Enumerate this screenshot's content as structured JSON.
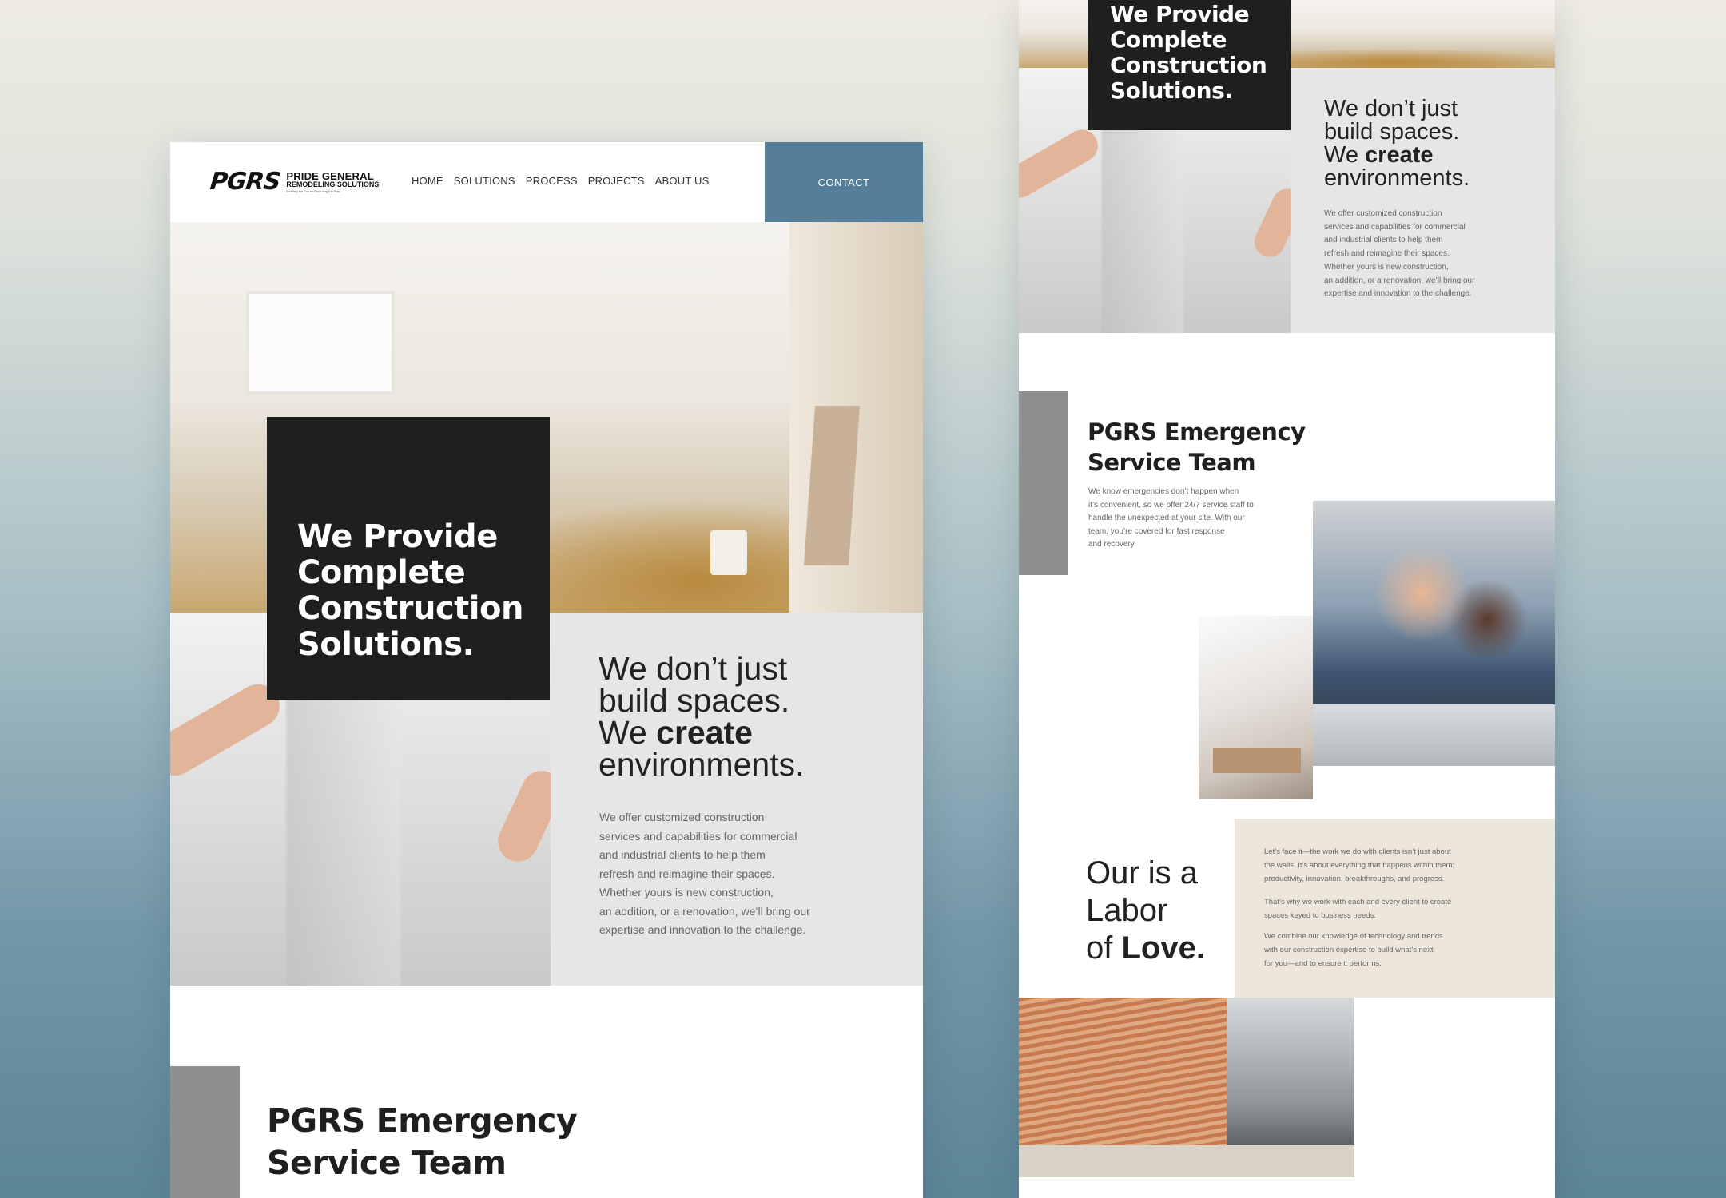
{
  "nav": {
    "logo_mark": "PGRS",
    "logo_line1": "PRIDE GENERAL",
    "logo_line2": "REMODELING SOLUTIONS",
    "logo_line3": "Building the Future Restoring the Past",
    "items": [
      "HOME",
      "SOLUTIONS",
      "PROCESS",
      "PROJECTS",
      "ABOUT US"
    ],
    "contact": "CONTACT"
  },
  "hero": {
    "lines": [
      "We Provide",
      "Complete",
      "Construction",
      "Solutions."
    ]
  },
  "tagline": {
    "line1": "We don’t just",
    "line2": "build spaces.",
    "line3_pre": "We ",
    "line3_bold": "create",
    "line4": "environments.",
    "body": [
      "We offer customized construction",
      "services and capabilities for commercial",
      "and industrial clients to help them",
      "refresh and reimagine their spaces.",
      "Whether yours is new construction,",
      "an addition, or a renovation, we’ll bring our",
      "expertise and innovation to the challenge."
    ]
  },
  "team": {
    "title_line1": "PGRS Emergency",
    "title_line2": "Service Team",
    "body": [
      "We know emergencies don’t happen when",
      "it’s convenient, so we offer 24/7 service staff to",
      "handle the unexpected at your site. With our",
      "team, you’re covered for fast response",
      "and recovery."
    ]
  },
  "love": {
    "line1": "Our is a",
    "line2": "Labor",
    "line3_pre": "of ",
    "line3_bold": "Love.",
    "p1": [
      "Let’s face it—the work we do with clients isn’t just about",
      "the walls. It’s about everything that happens within them:",
      "productivity, innovation, breakthroughs, and progress."
    ],
    "p2": [
      "That’s why we work with each and every client to create",
      "spaces keyed to business needs."
    ],
    "p3": [
      "We combine our knowledge of technology and trends",
      "with our construction expertise to build what’s next",
      "for you—and to ensure it performs."
    ]
  },
  "colors": {
    "accent": "#557f98",
    "dark": "#1f1f1f",
    "panel_grey": "#e6e6e6",
    "bar_grey": "#8f8f8f",
    "beige": "#ece7da"
  }
}
